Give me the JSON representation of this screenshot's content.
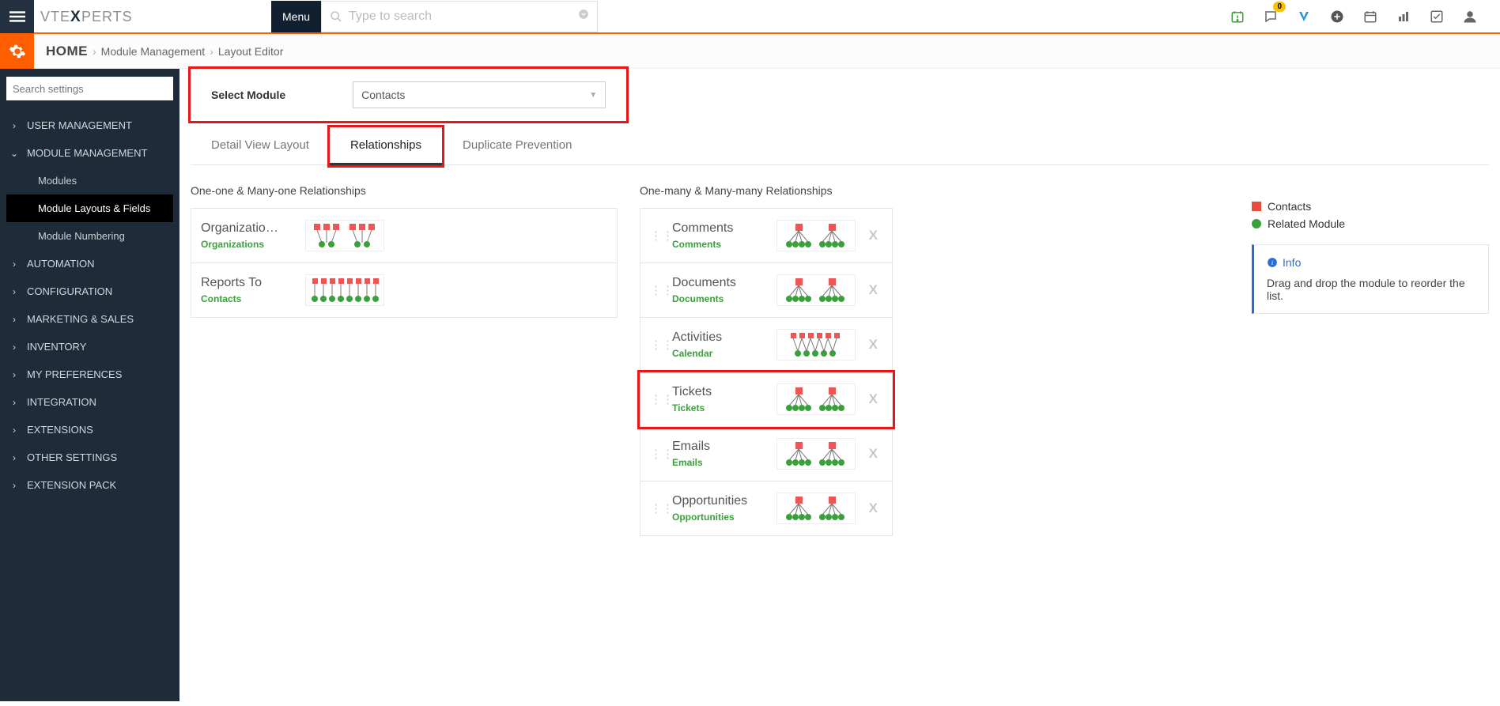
{
  "header": {
    "menu_btn": "Menu",
    "search_placeholder": "Type to search",
    "notif_badge": "0"
  },
  "breadcrumb": {
    "home": "HOME",
    "a": "Module Management",
    "b": "Layout Editor"
  },
  "sidebar": {
    "search_placeholder": "Search settings",
    "items": [
      {
        "label": "USER MANAGEMENT",
        "open": false
      },
      {
        "label": "MODULE MANAGEMENT",
        "open": true,
        "children": [
          {
            "label": "Modules"
          },
          {
            "label": "Module Layouts & Fields",
            "active": true
          },
          {
            "label": "Module Numbering"
          }
        ]
      },
      {
        "label": "AUTOMATION"
      },
      {
        "label": "CONFIGURATION"
      },
      {
        "label": "MARKETING & SALES"
      },
      {
        "label": "INVENTORY"
      },
      {
        "label": "MY PREFERENCES"
      },
      {
        "label": "INTEGRATION"
      },
      {
        "label": "EXTENSIONS"
      },
      {
        "label": "OTHER SETTINGS"
      },
      {
        "label": "EXTENSION PACK"
      }
    ]
  },
  "module_select": {
    "label": "Select Module",
    "value": "Contacts"
  },
  "tabs": {
    "t1": "Detail View Layout",
    "t2": "Relationships",
    "t3": "Duplicate Prevention"
  },
  "cols": {
    "left_title": "One-one & Many-one Relationships",
    "right_title": "One-many & Many-many Relationships"
  },
  "left": [
    {
      "title": "Organizatio…",
      "sub": "Organizations",
      "type": "many-one"
    },
    {
      "title": "Reports To",
      "sub": "Contacts",
      "type": "many-one"
    }
  ],
  "right": [
    {
      "title": "Comments",
      "sub": "Comments",
      "del": true
    },
    {
      "title": "Documents",
      "sub": "Documents",
      "del": true
    },
    {
      "title": "Activities",
      "sub": "Calendar",
      "del": true
    },
    {
      "title": "Tickets",
      "sub": "Tickets",
      "del": true,
      "hl": true
    },
    {
      "title": "Emails",
      "sub": "Emails",
      "del": true
    },
    {
      "title": "Opportunities",
      "sub": "Opportunities",
      "del": true
    }
  ],
  "legend": {
    "a": "Contacts",
    "b": "Related Module"
  },
  "info": {
    "title": "Info",
    "body": "Drag and drop the module to reorder the list."
  }
}
